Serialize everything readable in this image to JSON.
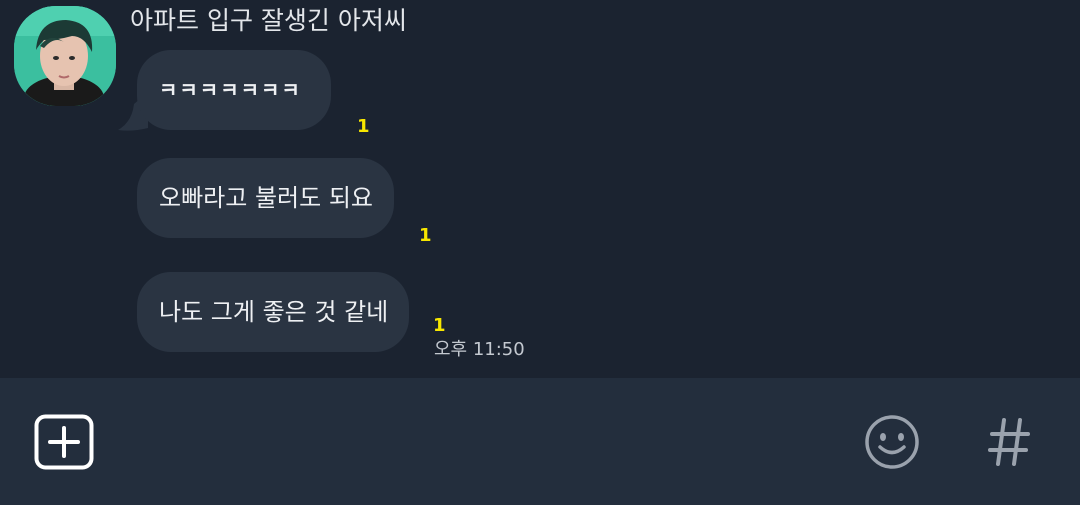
{
  "chat": {
    "sender_name": "아파트 입구 잘생긴 아저씨",
    "messages": [
      {
        "text": "ㅋㅋㅋㅋㅋㅋㅋ",
        "unread": "1"
      },
      {
        "text": "오빠라고 불러도 되요",
        "unread": "1"
      },
      {
        "text": "나도 그게 좋은 것 같네",
        "unread": "1",
        "time": "오후 11:50"
      }
    ]
  },
  "input_bar": {
    "icons": [
      "plus-square-icon",
      "emoji-icon",
      "hashtag-icon"
    ]
  },
  "colors": {
    "background": "#1b2330",
    "bubble": "#2a3442",
    "input_bar": "#232e3d",
    "unread": "#f7e600",
    "text": "#eef0f3"
  }
}
